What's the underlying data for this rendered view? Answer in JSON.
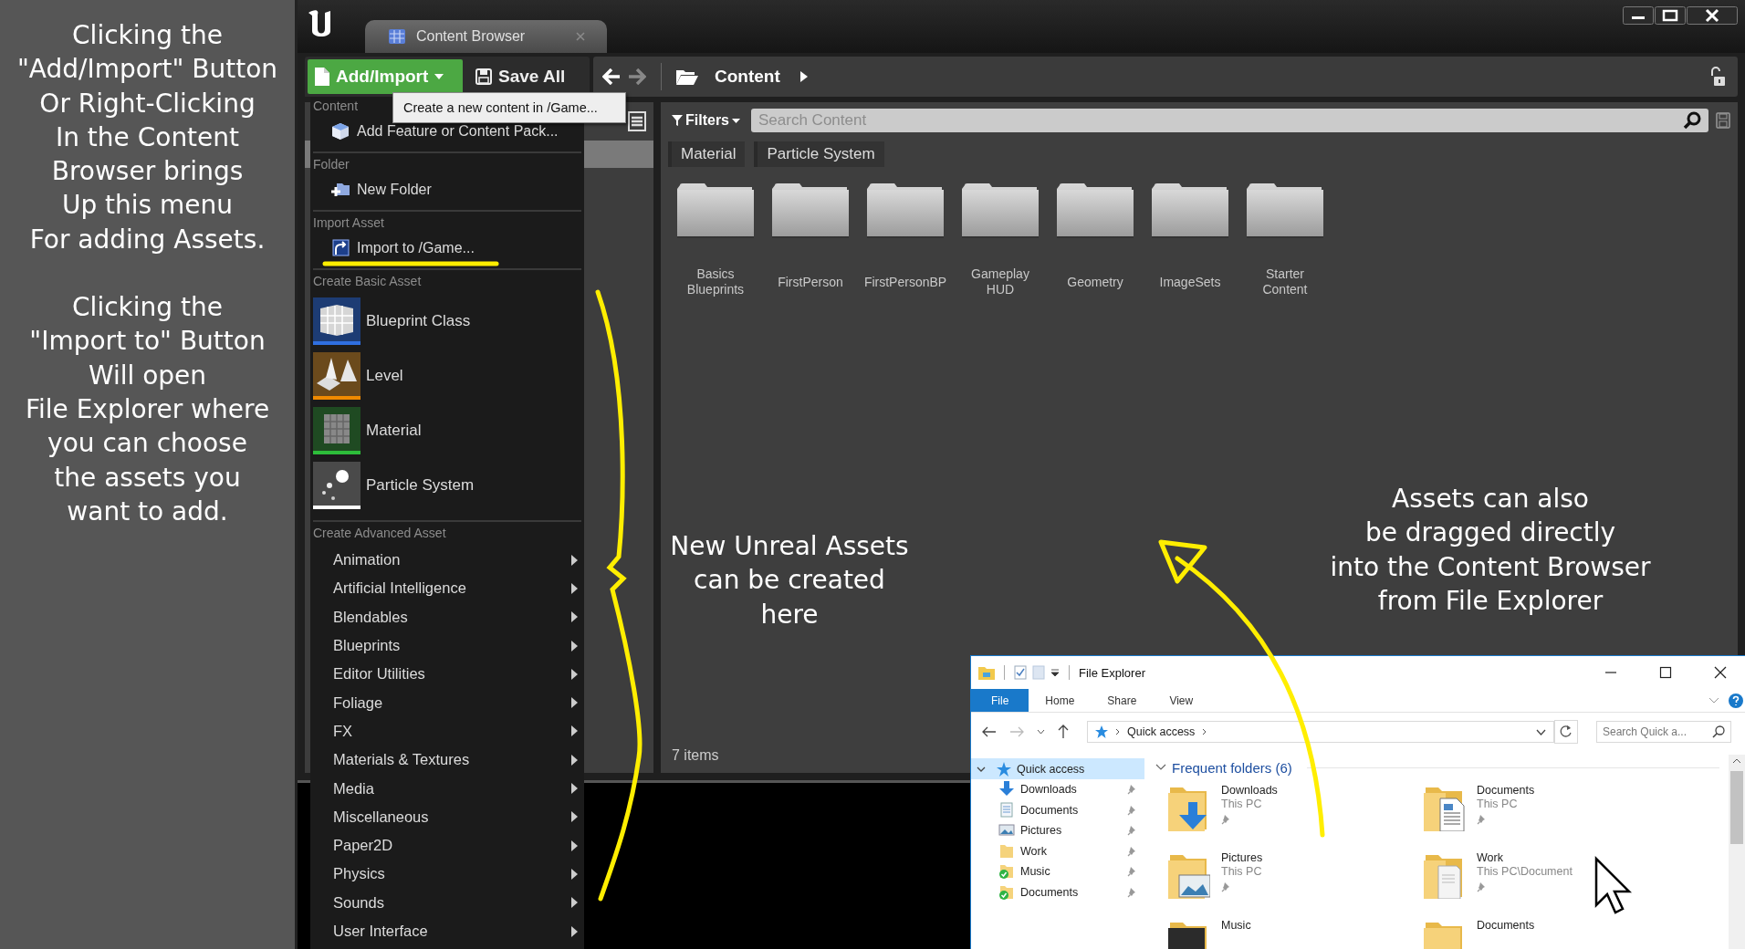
{
  "note_panel": {
    "paragraphs": [
      "Clicking the\n\"Add/Import\" Button\nOr Right-Clicking\nIn the Content\nBrowser brings\nUp this menu\nFor adding Assets.",
      "Clicking the\n\"Import to\" Button\nWill open\nFile Explorer where\nyou can choose\nthe assets you\nwant to add."
    ]
  },
  "window": {
    "tabs": [
      {
        "label": "Content Browser",
        "selected": true
      }
    ]
  },
  "toolbar": {
    "add_button": "Add/Import",
    "save_button": "Save All",
    "path": [
      "Content"
    ],
    "tooltip": "Create a new content in /Game..."
  },
  "menu": {
    "sections": [
      {
        "header": "Content",
        "items": [
          {
            "kind": "feature",
            "label": "Add Feature or Content Pack..."
          }
        ]
      },
      {
        "header": "Folder",
        "items": [
          {
            "kind": "folder",
            "label": "New Folder"
          }
        ]
      },
      {
        "header": "Import Asset",
        "items": [
          {
            "kind": "import",
            "label": "Import to /Game..."
          }
        ]
      },
      {
        "header": "Create Basic Asset",
        "items": [
          {
            "kind": "asset",
            "label": "Blueprint Class",
            "color": "#2f6fe0"
          },
          {
            "kind": "asset",
            "label": "Level",
            "color": "#f08a00"
          },
          {
            "kind": "asset",
            "label": "Material",
            "color": "#2dbd3a"
          },
          {
            "kind": "asset",
            "label": "Particle System",
            "color": "#ffffff"
          }
        ]
      },
      {
        "header": "Create Advanced Asset",
        "items": [
          {
            "kind": "submenu",
            "label": "Animation"
          },
          {
            "kind": "submenu",
            "label": "Artificial Intelligence"
          },
          {
            "kind": "submenu",
            "label": "Blendables"
          },
          {
            "kind": "submenu",
            "label": "Blueprints"
          },
          {
            "kind": "submenu",
            "label": "Editor Utilities"
          },
          {
            "kind": "submenu",
            "label": "Foliage"
          },
          {
            "kind": "submenu",
            "label": "FX"
          },
          {
            "kind": "submenu",
            "label": "Materials & Textures"
          },
          {
            "kind": "submenu",
            "label": "Media"
          },
          {
            "kind": "submenu",
            "label": "Miscellaneous"
          },
          {
            "kind": "submenu",
            "label": "Paper2D"
          },
          {
            "kind": "submenu",
            "label": "Physics"
          },
          {
            "kind": "submenu",
            "label": "Sounds"
          },
          {
            "kind": "submenu",
            "label": "User Interface"
          }
        ]
      }
    ]
  },
  "content": {
    "filters_button": "Filters",
    "search": {
      "placeholder": "Search Content"
    },
    "filter_tags": [
      "Material",
      "Particle System"
    ],
    "folders": [
      "Basics\nBlueprints",
      "FirstPerson",
      "FirstPersonBP",
      "Gameplay\nHUD",
      "Geometry",
      "ImageSets",
      "Starter\nContent"
    ],
    "item_count": "7 items"
  },
  "annotations": [
    {
      "text": "New Unreal Assets\ncan be created\nhere"
    },
    {
      "text": "Assets can also\nbe dragged directly\ninto the Content Browser\nfrom File Explorer"
    }
  ],
  "file_explorer": {
    "title": "File Explorer",
    "ribbon_tabs": [
      {
        "label": "File",
        "selected": true
      },
      {
        "label": "Home",
        "selected": false
      },
      {
        "label": "Share",
        "selected": false
      },
      {
        "label": "View",
        "selected": false
      }
    ],
    "address": "Quick access",
    "search": {
      "placeholder": "Search Quick a..."
    },
    "navigation": [
      {
        "label": "Quick access",
        "selected": true,
        "expanded": true,
        "children": [
          {
            "label": "Downloads",
            "kind": "downloads",
            "pinned": true
          },
          {
            "label": "Documents",
            "kind": "documents",
            "pinned": true
          },
          {
            "label": "Pictures",
            "kind": "pictures",
            "pinned": true
          },
          {
            "label": "Work",
            "kind": "folder",
            "pinned": true
          },
          {
            "label": "Music",
            "kind": "synced",
            "pinned": true
          },
          {
            "label": "Documents",
            "kind": "synced",
            "pinned": true
          }
        ]
      }
    ],
    "section": "Frequent folders (6)",
    "frequent_folders": [
      {
        "name": "Downloads",
        "location": "This PC",
        "kind": "downloads",
        "pinned": true
      },
      {
        "name": "Documents",
        "location": "This PC",
        "kind": "documents",
        "pinned": true
      },
      {
        "name": "Pictures",
        "location": "This PC",
        "kind": "pictures",
        "pinned": true
      },
      {
        "name": "Work",
        "location": "This PC\\Document",
        "kind": "paper",
        "pinned": true
      },
      {
        "name": "Music",
        "kind": "music"
      },
      {
        "name": "Documents",
        "kind": "folder"
      }
    ]
  }
}
